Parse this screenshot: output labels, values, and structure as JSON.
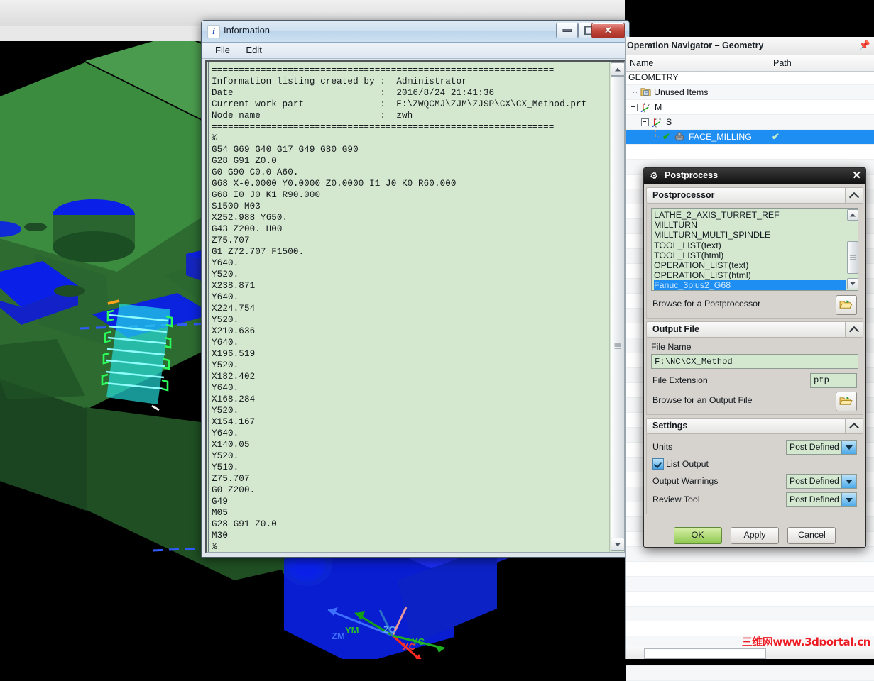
{
  "info_window": {
    "title": "Information",
    "icon": "info-icon",
    "menu": [
      "File",
      "Edit"
    ],
    "window_buttons": {
      "minimize": "minimize-icon",
      "maximize": "maximize-icon",
      "close": "close-icon"
    },
    "body_text": "===============================================================\nInformation listing created by :  Administrator\nDate                           :  2016/8/24 21:41:36\nCurrent work part              :  E:\\ZWQCMJ\\ZJM\\ZJSP\\CX\\CX_Method.prt\nNode name                      :  zwh\n===============================================================\n%\nG54 G69 G40 G17 G49 G80 G90\nG28 G91 Z0.0\nG0 G90 C0.0 A60.\nG68 X-0.0000 Y0.0000 Z0.0000 I1 J0 K0 R60.000\nG68 I0 J0 K1 R90.000\nS1500 M03\nX252.988 Y650.\nG43 Z200. H00\nZ75.707\nG1 Z72.707 F1500.\nY640.\nY520.\nX238.871\nY640.\nX224.754\nY520.\nX210.636\nY640.\nX196.519\nY520.\nX182.402\nY640.\nX168.284\nY520.\nX154.167\nY640.\nX140.05\nY520.\nY510.\nZ75.707\nG0 Z200.\nG49\nM05\nG28 G91 Z0.0\nM30\n%"
  },
  "navigator": {
    "title": "Operation Navigator – Geometry",
    "pin_icon": "pin-icon",
    "columns": {
      "name": "Name",
      "path": "Path"
    },
    "rows": [
      {
        "label": "GEOMETRY",
        "indent": 0,
        "path": "",
        "selected": false
      },
      {
        "label": "Unused Items",
        "indent": 1,
        "path": "",
        "selected": false,
        "icon": "folder-icon"
      },
      {
        "label": "M",
        "indent": 1,
        "path": "",
        "selected": false,
        "icon": "csys-icon"
      },
      {
        "label": "S",
        "indent": 2,
        "path": "",
        "selected": false,
        "icon": "csys-icon"
      },
      {
        "label": "FACE_MILLING",
        "indent": 3,
        "path": "✔",
        "selected": true,
        "icon": "mill-tool-icon",
        "check": "✔"
      }
    ]
  },
  "postprocess": {
    "title": "Postprocess",
    "gear_icon": "gear-icon",
    "close_icon": "close-icon",
    "groups": {
      "postprocessor": {
        "label": "Postprocessor",
        "items": [
          "LATHE_2_AXIS_TURRET_REF",
          "MILLTURN",
          "MILLTURN_MULTI_SPINDLE",
          "TOOL_LIST(text)",
          "TOOL_LIST(html)",
          "OPERATION_LIST(text)",
          "OPERATION_LIST(html)",
          "Fanuc_3plus2_G68"
        ],
        "selected": "Fanuc_3plus2_G68",
        "browse_label": "Browse for a Postprocessor",
        "browse_icon": "folder-open-icon"
      },
      "output_file": {
        "label": "Output File",
        "file_name_label": "File Name",
        "file_name_value": "F:\\NC\\CX_Method",
        "file_extension_label": "File Extension",
        "file_extension_value": "ptp",
        "browse_label": "Browse for an Output File",
        "browse_icon": "folder-open-icon"
      },
      "settings": {
        "label": "Settings",
        "units_label": "Units",
        "units_value": "Post Defined",
        "list_output_label": "List Output",
        "list_output_checked": true,
        "output_warnings_label": "Output Warnings",
        "output_warnings_value": "Post Defined",
        "review_tool_label": "Review Tool",
        "review_tool_value": "Post Defined"
      }
    },
    "buttons": {
      "ok": "OK",
      "apply": "Apply",
      "cancel": "Cancel"
    }
  },
  "viewport": {
    "axes": [
      {
        "label": "YM",
        "color": "#27c227"
      },
      {
        "label": "ZC",
        "color": "#5ea8ff"
      },
      {
        "label": "YC",
        "color": "#27c227"
      },
      {
        "label": "ZM",
        "color": "#3f6fff"
      },
      {
        "label": "XC",
        "color": "#ff3b30"
      }
    ],
    "part_color": "#2f7a34",
    "feature_color": "#0a20e8",
    "toolpath_color": "#25e6e6"
  },
  "watermark": "三维网www.3dportal.cn"
}
